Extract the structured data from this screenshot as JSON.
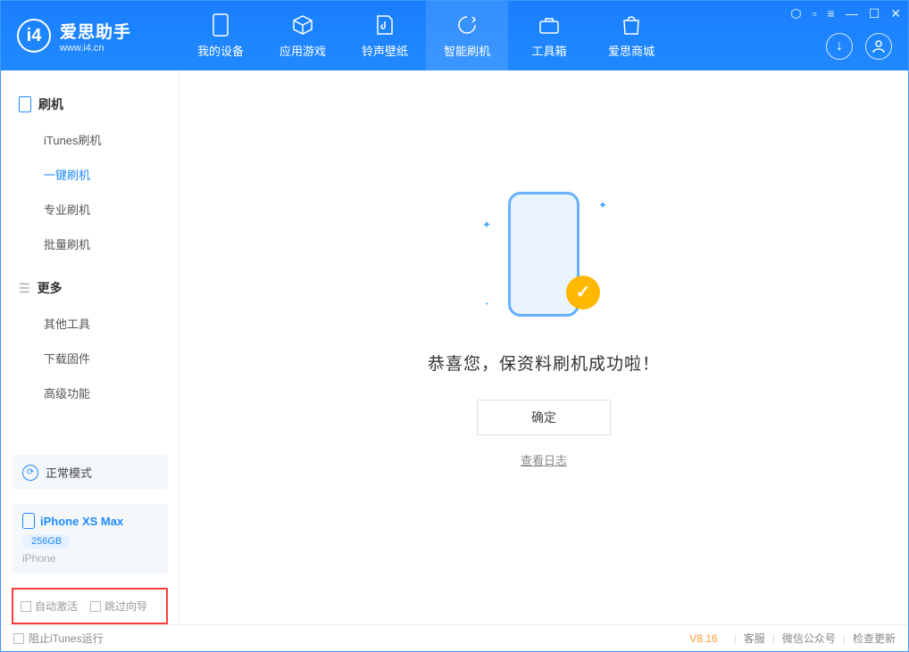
{
  "app": {
    "name": "爱思助手",
    "url": "www.i4.cn"
  },
  "nav": {
    "items": [
      {
        "label": "我的设备"
      },
      {
        "label": "应用游戏"
      },
      {
        "label": "铃声壁纸"
      },
      {
        "label": "智能刷机"
      },
      {
        "label": "工具箱"
      },
      {
        "label": "爱思商城"
      }
    ]
  },
  "sidebar": {
    "section1": {
      "title": "刷机",
      "items": [
        "iTunes刷机",
        "一键刷机",
        "专业刷机",
        "批量刷机"
      ]
    },
    "section2": {
      "title": "更多",
      "items": [
        "其他工具",
        "下载固件",
        "高级功能"
      ]
    }
  },
  "device": {
    "mode": "正常模式",
    "name": "iPhone XS Max",
    "storage": "256GB",
    "type": "iPhone"
  },
  "options": {
    "opt1": "自动激活",
    "opt2": "跳过向导"
  },
  "main": {
    "success_text": "恭喜您，保资料刷机成功啦！",
    "ok_label": "确定",
    "log_link": "查看日志"
  },
  "footer": {
    "block_itunes": "阻止iTunes运行",
    "version": "V8.16",
    "links": [
      "客服",
      "微信公众号",
      "检查更新"
    ]
  }
}
